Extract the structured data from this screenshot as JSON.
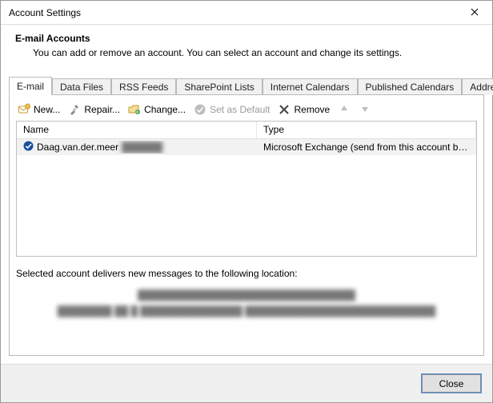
{
  "window": {
    "title": "Account Settings"
  },
  "header": {
    "title": "E-mail Accounts",
    "description": "You can add or remove an account. You can select an account and change its settings."
  },
  "tabs": [
    {
      "label": "E-mail",
      "active": true
    },
    {
      "label": "Data Files",
      "active": false
    },
    {
      "label": "RSS Feeds",
      "active": false
    },
    {
      "label": "SharePoint Lists",
      "active": false
    },
    {
      "label": "Internet Calendars",
      "active": false
    },
    {
      "label": "Published Calendars",
      "active": false
    },
    {
      "label": "Address Books",
      "active": false
    }
  ],
  "toolbar": {
    "new_label": "New...",
    "repair_label": "Repair...",
    "change_label": "Change...",
    "set_default_label": "Set as Default",
    "remove_label": "Remove"
  },
  "table": {
    "columns": {
      "name": "Name",
      "type": "Type"
    },
    "rows": [
      {
        "name_visible": "Daag.van.der.meer",
        "name_obscured": "██████",
        "type": "Microsoft Exchange (send from this account by def..."
      }
    ]
  },
  "location": {
    "label": "Selected account delivers new messages to the following location:",
    "line1": "████████████████████████████████",
    "line2": "████████ ██ █ ███████████████   ████████████████████████████"
  },
  "footer": {
    "close_label": "Close"
  }
}
